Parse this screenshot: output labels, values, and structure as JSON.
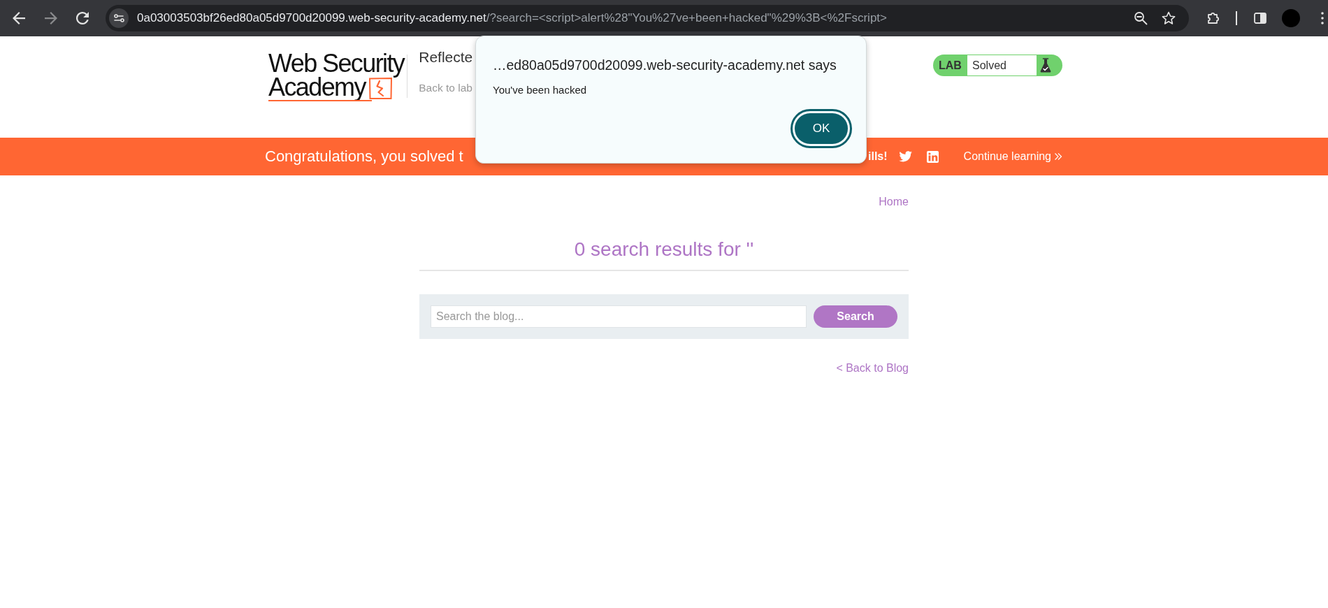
{
  "browser": {
    "toolbar": {
      "back": {
        "disabled": false
      },
      "forward": {
        "disabled": true
      }
    },
    "address_bar": {
      "host": "0a03003503bf26ed80a05d9700d20099.web-security-academy.net",
      "path": "/?search=<script>alert%28\"You%27ve+been+hacked\"%29%3B<%2Fscript>"
    }
  },
  "header": {
    "logo": {
      "line_1": "Web Security",
      "line_2": "Academy"
    },
    "title": "Reflecte",
    "back_link": "Back to lab",
    "lab_status": {
      "label": "LAB",
      "status": "Solved"
    }
  },
  "banner": {
    "message": "Congratulations, you solved t",
    "share_text": "ills!",
    "continue_link": "Continue learning"
  },
  "content": {
    "home_link": "Home",
    "heading": "0 search results for ''",
    "search": {
      "placeholder": "Search the blog...",
      "button": "Search"
    },
    "back_link": "< Back to Blog"
  },
  "dialog": {
    "title": "…ed80a05d9700d20099.web-security-academy.net says",
    "message": "You've been hacked",
    "ok_button": {
      "label": "OK",
      "focused": true
    }
  }
}
